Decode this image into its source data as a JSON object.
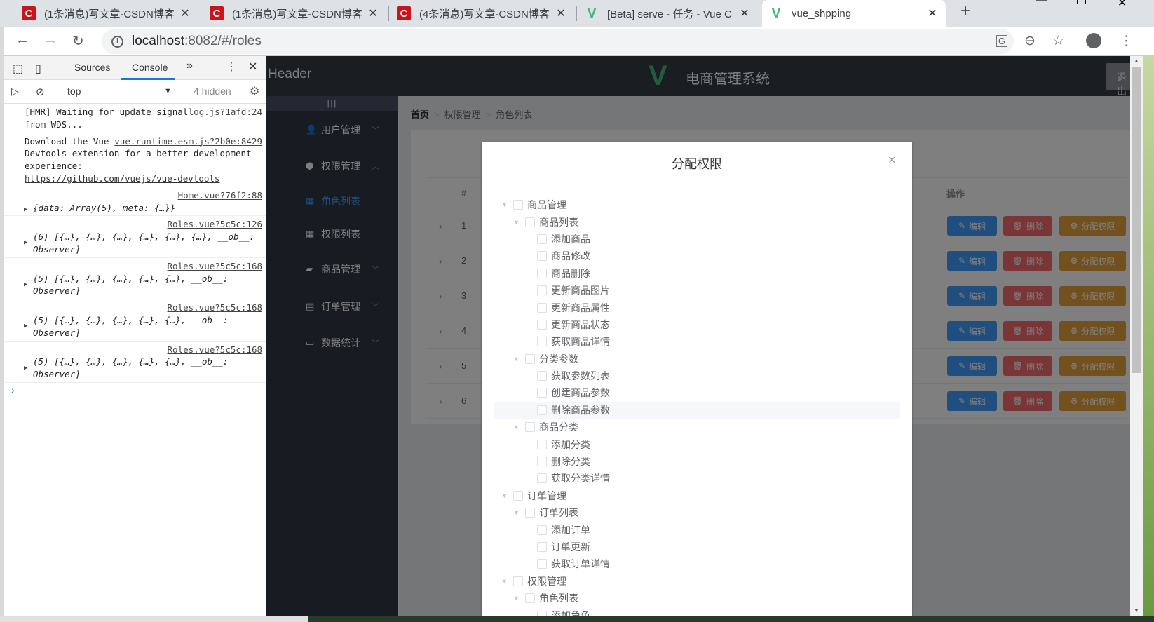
{
  "browser": {
    "tabs": [
      {
        "title": "(1条消息)写文章-CSDN博客",
        "icon": "csdn-icon"
      },
      {
        "title": "(1条消息)写文章-CSDN博客",
        "icon": "csdn-icon"
      },
      {
        "title": "(4条消息)写文章-CSDN博客",
        "icon": "csdn-icon"
      },
      {
        "title": "[Beta] serve - 任务 - Vue C",
        "icon": "vue-icon"
      },
      {
        "title": "vue_shpping",
        "icon": "vue-icon",
        "active": true
      }
    ],
    "new_tab": "+",
    "url_host": "localhost",
    "url_rest": ":8082/#/roles"
  },
  "devtools": {
    "tabs": [
      "Sources",
      "Console"
    ],
    "active_tab": "Console",
    "more": "»",
    "context": "top",
    "hidden": "4 hidden",
    "messages": [
      {
        "text": "[HMR] Waiting for update signal from WDS...",
        "source": "log.js?1afd:24"
      },
      {
        "text": "Download the Vue Devtools extension for a better development experience:",
        "link": "https://github.com/vuejs/vue-devtools",
        "source": "vue.runtime.esm.js?2b0e:8429"
      },
      {
        "text": "{data: Array(5), meta: {…}}",
        "source": "Home.vue?76f2:88"
      },
      {
        "text": "(6) [{…}, {…}, {…}, {…}, {…}, {…}, __ob__: Observer]",
        "source": "Roles.vue?5c5c:126"
      },
      {
        "text": "(5) [{…}, {…}, {…}, {…}, {…}, __ob__: Observer]",
        "source": "Roles.vue?5c5c:168"
      },
      {
        "text": "(5) [{…}, {…}, {…}, {…}, {…}, __ob__: Observer]",
        "source": "Roles.vue?5c5c:168"
      },
      {
        "text": "(5) [{…}, {…}, {…}, {…}, {…}, __ob__: Observer]",
        "source": "Roles.vue?5c5c:168"
      }
    ],
    "prompt": "›"
  },
  "app": {
    "header_text": "Header",
    "title": "电商管理系统",
    "logout": "退出",
    "toggle": "|||",
    "sidebar": [
      {
        "label": "用户管理",
        "icon": "user-icon",
        "chevron": "down"
      },
      {
        "label": "权限管理",
        "icon": "box-icon",
        "chevron": "up"
      },
      {
        "label": "角色列表",
        "icon": "grid-icon",
        "active": true
      },
      {
        "label": "权限列表",
        "icon": "grid-icon"
      },
      {
        "label": "商品管理",
        "icon": "bag-icon",
        "chevron": "down"
      },
      {
        "label": "订单管理",
        "icon": "document-icon",
        "chevron": "down"
      },
      {
        "label": "数据统计",
        "icon": "chart-icon",
        "chevron": "down"
      }
    ],
    "breadcrumb": [
      "首页",
      "权限管理",
      "角色列表"
    ],
    "table": {
      "headers": {
        "index": "#",
        "actions": "操作"
      },
      "rows": [
        "1",
        "2",
        "3",
        "4",
        "5",
        "6"
      ],
      "buttons": {
        "edit": "编辑",
        "delete": "删除",
        "assign": "分配权限"
      },
      "colors": {
        "edit": "#409eff",
        "delete": "#f56c6c",
        "assign": "#e6a23c"
      }
    }
  },
  "dialog": {
    "title": "分配权限",
    "close": "×",
    "tree": [
      {
        "label": "商品管理",
        "children": [
          {
            "label": "商品列表",
            "children": [
              "添加商品",
              "商品修改",
              "商品删除",
              "更新商品图片",
              "更新商品属性",
              "更新商品状态",
              "获取商品详情"
            ]
          },
          {
            "label": "分类参数",
            "children": [
              "获取参数列表",
              "创建商品参数",
              "删除商品参数"
            ]
          },
          {
            "label": "商品分类",
            "children": [
              "添加分类",
              "删除分类",
              "获取分类详情"
            ]
          }
        ]
      },
      {
        "label": "订单管理",
        "children": [
          {
            "label": "订单列表",
            "children": [
              "添加订单",
              "订单更新",
              "获取订单详情"
            ]
          }
        ]
      },
      {
        "label": "权限管理",
        "children": [
          {
            "label": "角色列表",
            "children": [
              "添加角色"
            ]
          }
        ]
      }
    ],
    "hovered": "删除商品参数"
  }
}
